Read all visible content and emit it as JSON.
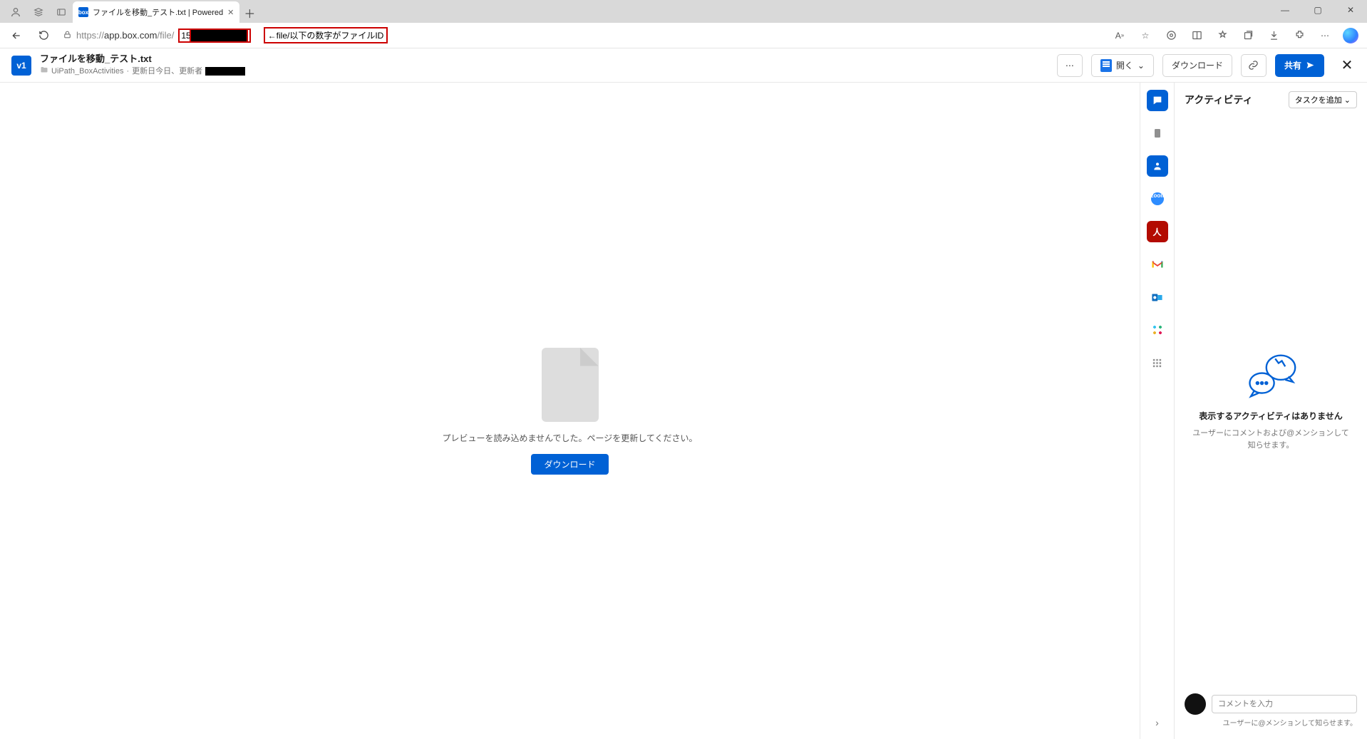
{
  "browser": {
    "tab_title": "ファイルを移動_テスト.txt | Powered",
    "url_prefix": "https://",
    "url_host": "app.box.com",
    "url_path": "/file/",
    "hidden_id_prefix": "15",
    "annotation": "←file/以下の数字がファイルID"
  },
  "header": {
    "version": "v1",
    "filename": "ファイルを移動_テスト.txt",
    "folder": "UiPath_BoxActivities",
    "meta_separator": " · ",
    "updated_label": "更新日今日、更新者",
    "open_label": "開く",
    "download_label": "ダウンロード",
    "share_label": "共有"
  },
  "preview": {
    "message": "プレビューを読み込めませんでした。ページを更新してください。",
    "download_btn": "ダウンロード"
  },
  "activity": {
    "title": "アクティビティ",
    "add_task": "タスクを追加",
    "empty_title": "表示するアクティビティはありません",
    "empty_sub": "ユーザーにコメントおよび@メンションして知らせます。",
    "comment_placeholder": "コメントを入力",
    "footer_hint": "ユーザーに@メンションして知らせます。"
  }
}
